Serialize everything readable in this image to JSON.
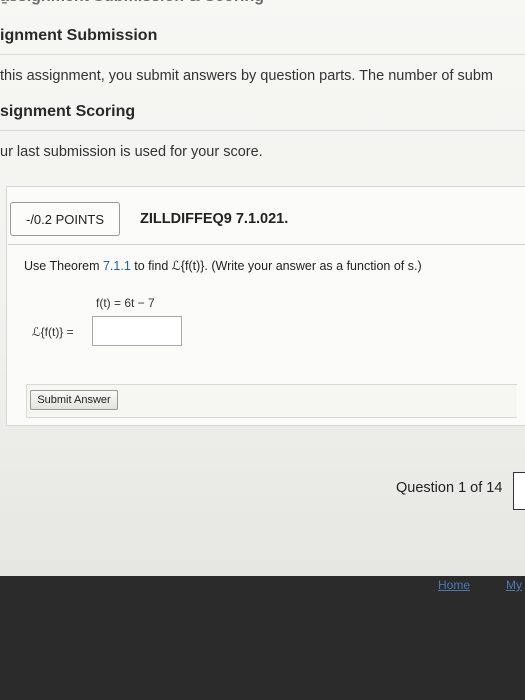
{
  "header": {
    "assignment_submission_heading": "ignment Submission",
    "assignment_submission_text": "this assignment, you submit answers by question parts. The number of subm",
    "assignment_scoring_heading": "signment Scoring",
    "assignment_scoring_text": "ur last submission is used for your score."
  },
  "question": {
    "points": "-/0.2 POINTS",
    "id": "ZILLDIFFEQ9 7.1.021.",
    "prompt_prefix": "Use Theorem ",
    "prompt_link": "7.1.1",
    "prompt_suffix": " to find ℒ{f(t)}. (Write your answer as a function of s.)",
    "function_text": "f(t) = 6t − 7",
    "answer_label": "ℒ{f(t)} =",
    "answer_value": "",
    "submit_label": "Submit Answer"
  },
  "navigation": {
    "question_counter": "Question 1 of 14"
  },
  "footer": {
    "home_link": "Home",
    "my_link": "My"
  }
}
